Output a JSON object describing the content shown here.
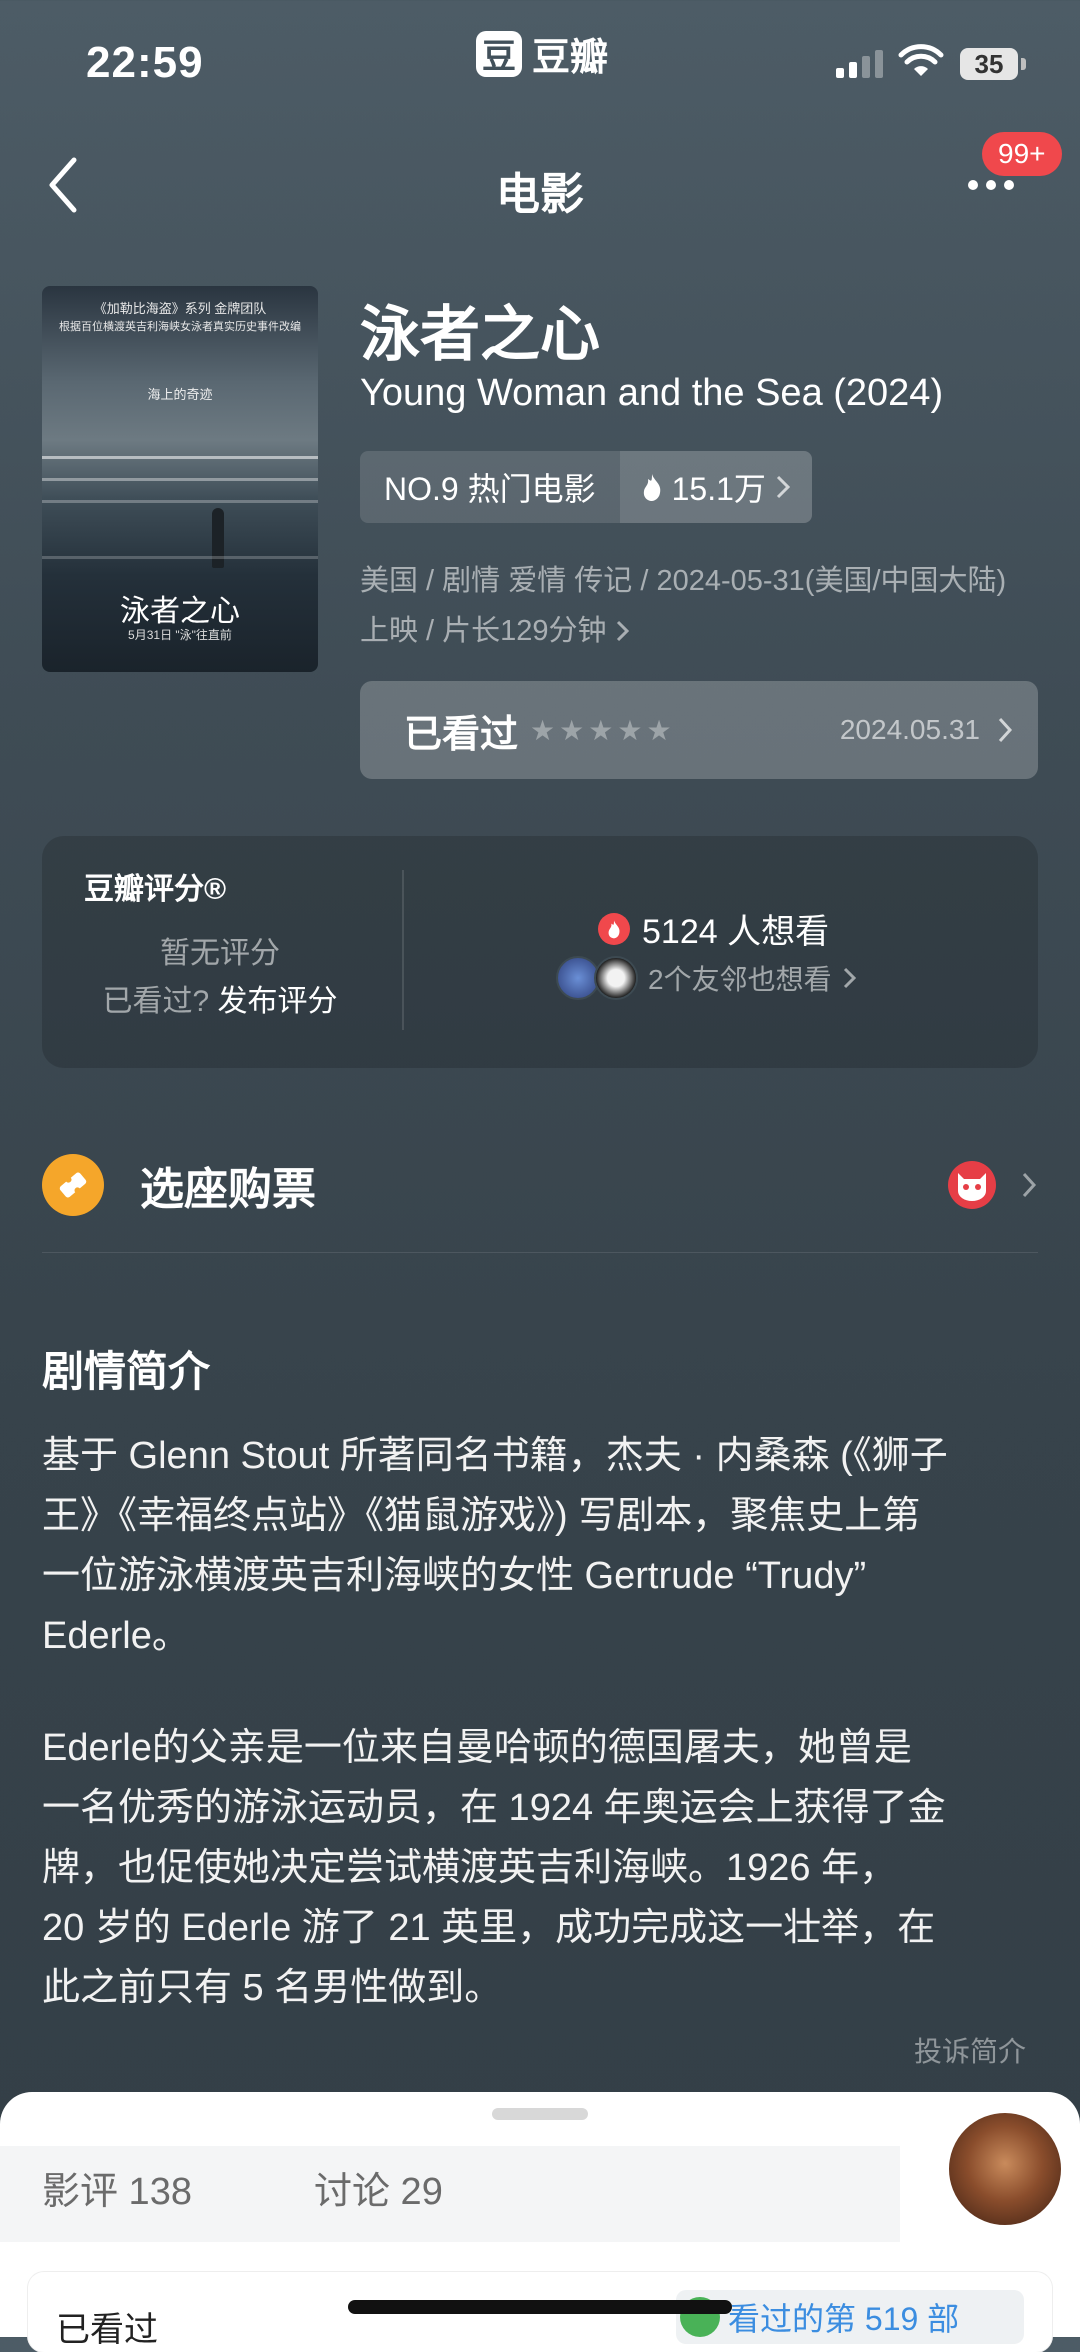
{
  "status": {
    "time": "22:59",
    "app_name": "豆瓣",
    "app_logo_char": "豆",
    "battery": "35"
  },
  "nav": {
    "title": "电影",
    "badge": "99+"
  },
  "poster": {
    "series_line": "《加勒比海盗》系列 金牌团队",
    "tagline": "根据百位横渡英吉利海峡女泳者真实历史事件改编",
    "mid_line": "海上的奇迹",
    "title": "泳者之心",
    "date_line": "5月31日 \"泳\"往直前"
  },
  "movie": {
    "title_cn": "泳者之心",
    "title_en": "Young Woman and the Sea (2024)",
    "rank": "NO.9 热门电影",
    "heat": "15.1万",
    "meta": "美国 / 剧情 爱情 传记 / 2024-05-31(美国/中国大陆) 上映 / 片长129分钟",
    "watched_label": "已看过",
    "watched_date": "2024.05.31",
    "stars": 0
  },
  "rating": {
    "header": "豆瓣评分®",
    "no_rating": "暂无评分",
    "seen_prefix": "已看过?",
    "seen_action": "发布评分",
    "want_count": "5124 人想看",
    "friends": "2个友邻也想看"
  },
  "tickets": {
    "label": "选座购票"
  },
  "synopsis": {
    "heading": "剧情简介",
    "p1_lines": [
      "基于 Glenn Stout 所著同名书籍，杰夫 · 内桑森 (《狮子",
      "王》《幸福终点站》《猫鼠游戏》) 写剧本，聚焦史上第",
      "一位游泳横渡英吉利海峡的女性 Gertrude “Trudy”",
      "Ederle。"
    ],
    "p2_lines": [
      "Ederle的父亲是一位来自曼哈顿的德国屠夫，她曾是",
      "一名优秀的游泳运动员，在 1924 年奥运会上获得了金",
      "牌，也促使她决定尝试横渡英吉利海峡。1926 年，",
      "20 岁的 Ederle 游了 21 英里，成功完成这一壮举，在",
      "此之前只有 5 名男性做到。"
    ],
    "report": "投诉简介"
  },
  "sheet": {
    "tab_reviews": "影评 138",
    "tab_discuss": "讨论 29",
    "card_label": "已看过",
    "card_right": "看过的第 519 部"
  }
}
